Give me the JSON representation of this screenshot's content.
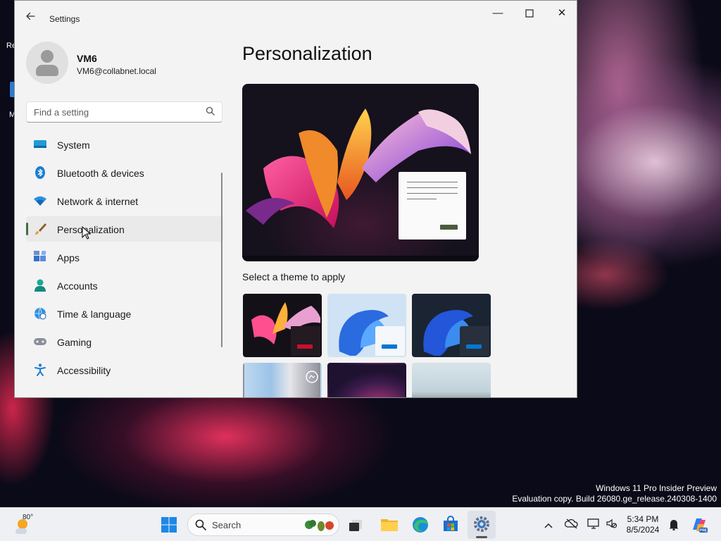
{
  "desktop": {
    "edge_text_1": "Re",
    "edge_text_2": "M",
    "watermark_line1": "Windows 11 Pro Insider Preview",
    "watermark_line2": "Evaluation copy. Build 26080.ge_release.240308-1400"
  },
  "window": {
    "title": "Settings",
    "back_icon": "back-arrow-icon",
    "minimize_glyph": "—",
    "maximize_glyph": "☐",
    "close_glyph": "✕"
  },
  "user": {
    "name": "VM6",
    "email": "VM6@collabnet.local"
  },
  "search": {
    "placeholder": "Find a setting",
    "icon": "search-icon"
  },
  "nav": {
    "items": [
      {
        "label": "System",
        "icon": "system-icon",
        "selected": false
      },
      {
        "label": "Bluetooth & devices",
        "icon": "bluetooth-icon",
        "selected": false
      },
      {
        "label": "Network & internet",
        "icon": "network-icon",
        "selected": false
      },
      {
        "label": "Personalization",
        "icon": "brush-icon",
        "selected": true
      },
      {
        "label": "Apps",
        "icon": "apps-icon",
        "selected": false
      },
      {
        "label": "Accounts",
        "icon": "accounts-icon",
        "selected": false
      },
      {
        "label": "Time & language",
        "icon": "globe-clock-icon",
        "selected": false
      },
      {
        "label": "Gaming",
        "icon": "gamepad-icon",
        "selected": false
      },
      {
        "label": "Accessibility",
        "icon": "accessibility-icon",
        "selected": false
      }
    ]
  },
  "main": {
    "title": "Personalization",
    "select_theme_label": "Select a theme to apply",
    "themes": [
      {
        "name": "theme-glow-dark",
        "accent": "#c8102e"
      },
      {
        "name": "theme-bloom-light",
        "accent": "#0078d4"
      },
      {
        "name": "theme-bloom-dark",
        "accent": "#0078d4"
      },
      {
        "name": "theme-captured-motion",
        "accent": "#6b6b6b"
      },
      {
        "name": "theme-flow",
        "accent": "#6b3a7a"
      },
      {
        "name": "theme-sunrise",
        "accent": "#d8d8d8"
      }
    ]
  },
  "taskbar": {
    "weather_temp": "80°",
    "search_label": "Search",
    "time": "5:34 PM",
    "date": "8/5/2024",
    "icons": [
      "start-icon",
      "task-view-icon",
      "file-explorer-icon",
      "edge-icon",
      "store-icon",
      "settings-icon"
    ],
    "tray_icons": [
      "chevron-up-icon",
      "onedrive-offline-icon",
      "network-icon",
      "volume-muted-icon",
      "notification-icon",
      "copilot-icon"
    ]
  },
  "colors": {
    "window_bg": "#f3f3f3",
    "accent": "#3f6e42",
    "taskbar_bg": "#eef0f4"
  }
}
